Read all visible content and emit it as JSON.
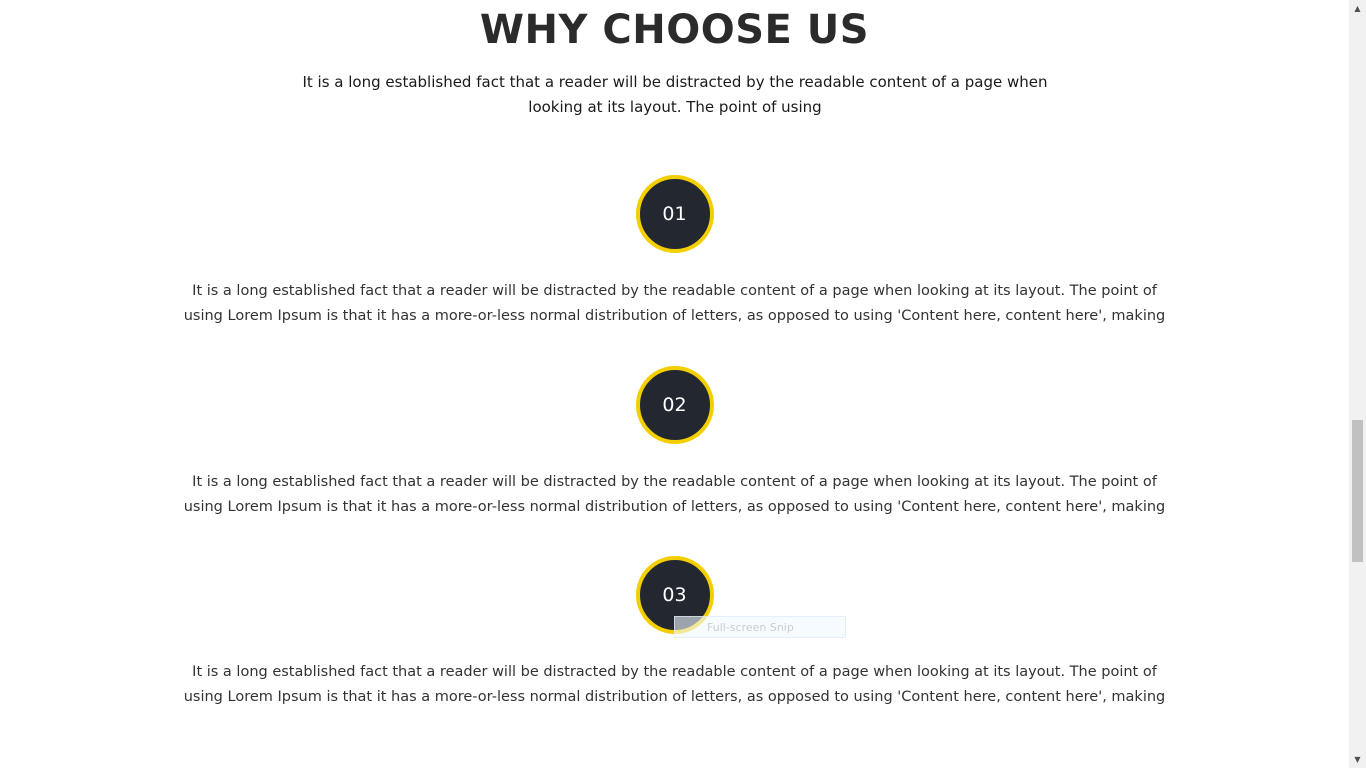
{
  "section": {
    "title": "WHY CHOOSE US",
    "intro": "It is a long established fact that a reader will be distracted by the readable content of a page when looking at its layout. The point of using"
  },
  "features": [
    {
      "number": "01",
      "text": "It is a long established fact that a reader will be distracted by the readable content of a page when looking at its layout. The point of using Lorem Ipsum is that it has a more-or-less normal distribution of letters, as opposed to using 'Content here, content here', making"
    },
    {
      "number": "02",
      "text": "It is a long established fact that a reader will be distracted by the readable content of a page when looking at its layout. The point of using Lorem Ipsum is that it has a more-or-less normal distribution of letters, as opposed to using 'Content here, content here', making"
    },
    {
      "number": "03",
      "text": "It is a long established fact that a reader will be distracted by the readable content of a page when looking at its layout. The point of using Lorem Ipsum is that it has a more-or-less normal distribution of letters, as opposed to using 'Content here, content here', making"
    }
  ],
  "overlay": {
    "snip_label": "Full-screen Snip"
  },
  "scrollbar": {
    "up_icon": "▲",
    "down_icon": "▼"
  },
  "colors": {
    "circle_fill": "#232730",
    "circle_border": "#f4cf00",
    "title": "#2b2b2b"
  }
}
